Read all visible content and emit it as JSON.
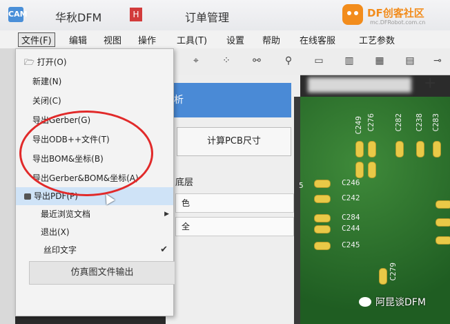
{
  "window": {
    "app_icon": "CAM",
    "app_title": "华秋DFM",
    "tab_icon": "H",
    "tab_title": "订单管理"
  },
  "watermark_top": {
    "brand": "DF创客社区",
    "url": "mc.DFRobot.com.cn"
  },
  "menubar": {
    "items": [
      "文件(F)",
      "编辑",
      "视图",
      "操作",
      "工具(T)",
      "设置",
      "帮助",
      "在线客服",
      "工艺参数"
    ]
  },
  "toolbar": {
    "icons": [
      "route-icon",
      "scatter-icon",
      "link-icon",
      "component-icon",
      "line-icon",
      "grid-icon",
      "table-icon",
      "chip-icon",
      "connector-icon"
    ]
  },
  "panel": {
    "analyze_label": "析",
    "calc_label": "计算PCB尺寸",
    "layer_label": "底层",
    "combo_a": "色",
    "combo_b": "全"
  },
  "file_menu": {
    "items": [
      {
        "label": "打开(O)"
      },
      {
        "label": "新建(N)"
      },
      {
        "label": "关闭(C)"
      },
      {
        "label": "导出Gerber(G)"
      },
      {
        "label": "导出ODB++文件(T)"
      },
      {
        "label": "导出BOM&坐标(B)"
      },
      {
        "label": "导出Gerber&BOM&坐标(A)"
      },
      {
        "label": "导出PDF(P)"
      },
      {
        "label": "最近浏览文档"
      },
      {
        "label": "退出(X)"
      },
      {
        "label": "丝印文字"
      }
    ],
    "submenu_arrow": "▶",
    "checkmark": "✔",
    "sim_button": "仿真图文件输出"
  },
  "pcb": {
    "labels_vertical": [
      "C249",
      "C276",
      "C282",
      "C238",
      "C283"
    ],
    "labels_horizontal": [
      "C246",
      "C242",
      "C284",
      "C244",
      "C245",
      "C279",
      "5"
    ]
  },
  "watermark_bottom": "阿昆谈DFM",
  "colors": {
    "annotation": "#e12a2a",
    "accent": "#4a8ad6",
    "pcb": "#2f7a30",
    "pad": "#e9c947"
  }
}
